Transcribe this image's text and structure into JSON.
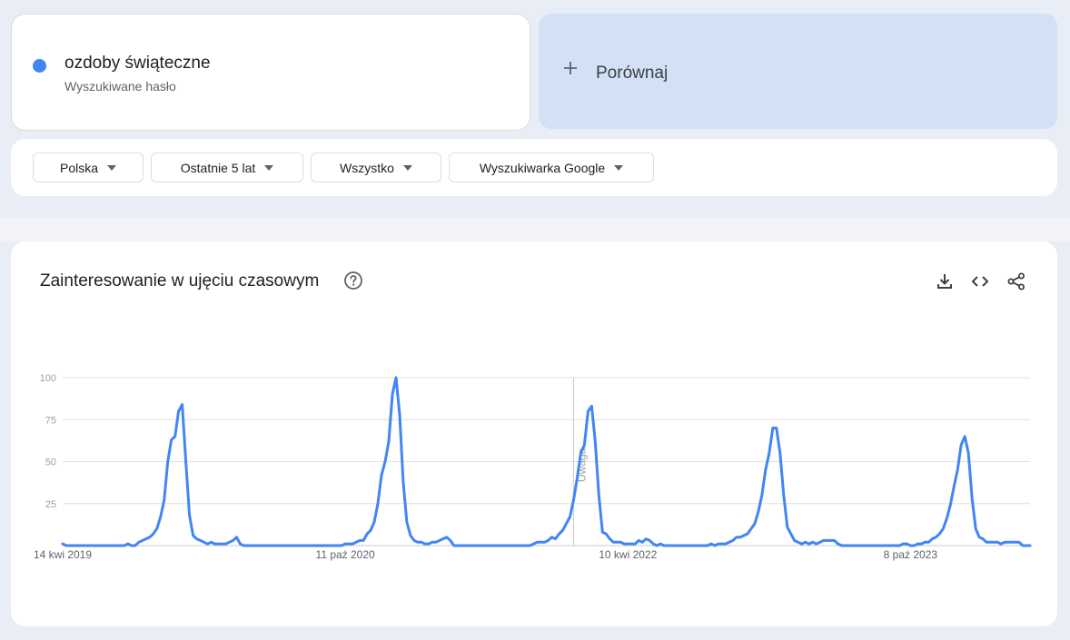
{
  "search_term": {
    "name": "ozdoby świąteczne",
    "type_label": "Wyszukiwane hasło",
    "color": "#4285f4"
  },
  "compare": {
    "label": "Porównaj",
    "icon": "plus-icon"
  },
  "filters": {
    "region": "Polska",
    "time_range": "Ostatnie 5 lat",
    "category": "Wszystko",
    "property": "Wyszukiwarka Google"
  },
  "chart_section": {
    "title": "Zainteresowanie w ujęciu czasowym",
    "help_icon": "help-circle-icon",
    "tools": [
      "download-icon",
      "embed-code-icon",
      "share-icon"
    ]
  },
  "chart_data": {
    "type": "line",
    "title": "",
    "xlabel": "",
    "ylabel": "",
    "ylim": [
      0,
      100
    ],
    "y_ticks": [
      "100",
      "75",
      "50",
      "25"
    ],
    "x_tick_labels": [
      "14 kwi 2019",
      "11 paź 2020",
      "10 kwi 2022",
      "8 paź 2023"
    ],
    "x_tick_index": [
      0,
      78,
      156,
      234
    ],
    "grid": true,
    "annotation": {
      "label": "Uwaga",
      "at_index": 141
    },
    "series": [
      {
        "color": "#4285f4",
        "values": [
          1,
          0,
          0,
          0,
          0,
          0,
          0,
          0,
          0,
          0,
          0,
          0,
          0,
          0,
          0,
          0,
          0,
          0,
          1,
          0,
          0,
          2,
          3,
          4,
          5,
          7,
          10,
          17,
          27,
          50,
          63,
          65,
          80,
          84,
          50,
          18,
          6,
          4,
          3,
          2,
          1,
          2,
          1,
          1,
          1,
          1,
          2,
          3,
          5,
          1,
          0,
          0,
          0,
          0,
          0,
          0,
          0,
          0,
          0,
          0,
          0,
          0,
          0,
          0,
          0,
          0,
          0,
          0,
          0,
          0,
          0,
          0,
          0,
          0,
          0,
          0,
          0,
          0,
          1,
          1,
          1,
          2,
          3,
          3,
          7,
          9,
          14,
          25,
          42,
          50,
          62,
          90,
          100,
          78,
          38,
          14,
          6,
          3,
          2,
          2,
          1,
          1,
          2,
          2,
          3,
          4,
          5,
          3,
          0,
          0,
          0,
          0,
          0,
          0,
          0,
          0,
          0,
          0,
          0,
          0,
          0,
          0,
          0,
          0,
          0,
          0,
          0,
          0,
          0,
          0,
          1,
          2,
          2,
          2,
          3,
          5,
          4,
          7,
          9,
          13,
          17,
          27,
          40,
          55,
          60,
          80,
          83,
          62,
          30,
          8,
          7,
          4,
          2,
          2,
          2,
          1,
          1,
          1,
          1,
          3,
          2,
          4,
          3,
          1,
          0,
          1,
          0,
          0,
          0,
          0,
          0,
          0,
          0,
          0,
          0,
          0,
          0,
          0,
          0,
          1,
          0,
          1,
          1,
          1,
          2,
          3,
          5,
          5,
          6,
          7,
          10,
          13,
          20,
          30,
          45,
          55,
          70,
          70,
          55,
          30,
          11,
          7,
          3,
          2,
          1,
          2,
          1,
          2,
          1,
          2,
          3,
          3,
          3,
          3,
          1,
          0,
          0,
          0,
          0,
          0,
          0,
          0,
          0,
          0,
          0,
          0,
          0,
          0,
          0,
          0,
          0,
          0,
          1,
          1,
          0,
          0,
          1,
          1,
          2,
          2,
          4,
          5,
          7,
          10,
          16,
          24,
          35,
          45,
          60,
          65,
          55,
          28,
          10,
          5,
          4,
          2,
          2,
          2,
          2,
          1,
          2,
          2,
          2,
          2,
          2,
          0,
          0,
          0
        ]
      }
    ]
  }
}
